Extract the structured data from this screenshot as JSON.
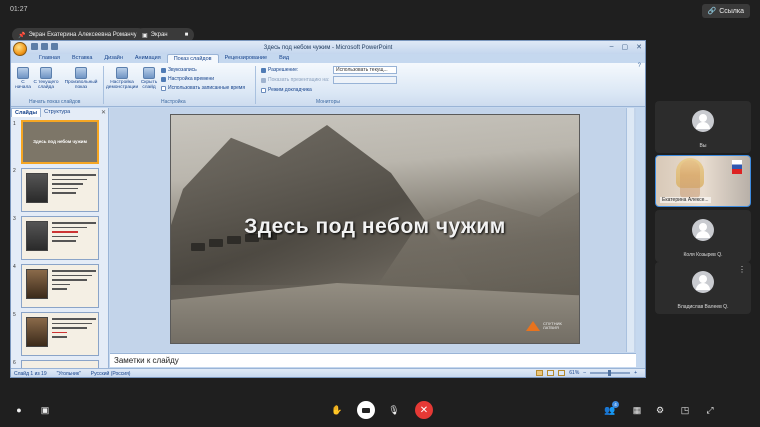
{
  "meeting": {
    "time": "01:27",
    "link_label": "Ссылка",
    "presenter_label": "Экран Екатерина Алексеевна Романчук",
    "screen_label": "Экран"
  },
  "ppt": {
    "title": "Здесь под небом чужим - Microsoft PowerPoint",
    "tabs": [
      "Главная",
      "Вставка",
      "Дизайн",
      "Анимация",
      "Показ слайдов",
      "Рецензирование",
      "Вид"
    ],
    "active_tab_index": 4,
    "ribbon": {
      "from_start": "С начала",
      "from_current": "С текущего слайда",
      "custom_show": "Произвольный показ",
      "group1_label": "Начать показ слайдов",
      "setup": "Настройка демонстрации",
      "hide_slide": "Скрыть слайд",
      "record_narration": "Звукозапись",
      "rehearse": "Настройка времени",
      "use_timings": "Использовать записанные время",
      "group2_label": "Настройка",
      "resolution": "Разрешение:",
      "resolution_value": "Использовать текущ...",
      "show_presentation_on": "Показать презентацию на:",
      "presenter_view": "Режим докладчика",
      "group3_label": "Мониторы"
    },
    "left_panel": {
      "tab_slides": "Слайды",
      "tab_outline": "Структура",
      "slide_numbers": [
        "1",
        "2",
        "3",
        "4",
        "5",
        "6"
      ],
      "first_thumb_title": "Здесь под небом чужим"
    },
    "slide": {
      "title": "Здесь под небом чужим",
      "logo_text": "СПУТНИК ЛАТВИЯ"
    },
    "notes_placeholder": "Заметки к слайду",
    "status": {
      "slide_info": "Слайд 1 из 19",
      "theme": "\"Угольник\"",
      "language": "Русский (Россия)",
      "zoom": "61%"
    }
  },
  "participants": [
    {
      "name": "Вы"
    },
    {
      "name": "Екатерина Алексе..."
    },
    {
      "name": "Коля Козырев Q."
    },
    {
      "name": "Владислав Валеев Q."
    }
  ],
  "toolbar": {
    "participants_count": "4"
  }
}
